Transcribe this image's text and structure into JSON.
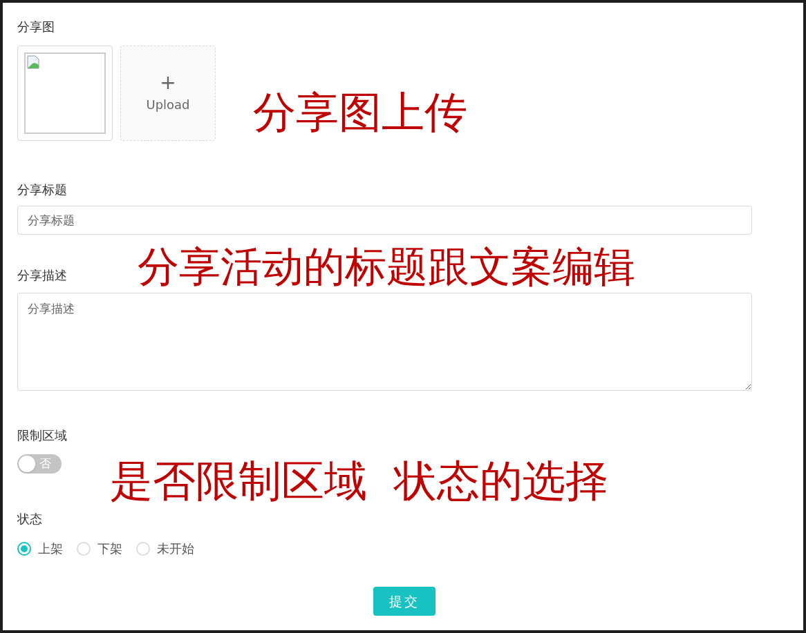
{
  "share_image": {
    "label": "分享图",
    "upload_label": "Upload",
    "upload_symbol": "+"
  },
  "share_title": {
    "label": "分享标题",
    "placeholder": "分享标题"
  },
  "share_description": {
    "label": "分享描述",
    "placeholder": "分享描述"
  },
  "region_limit": {
    "label": "限制区域",
    "on": false,
    "off_text": "否"
  },
  "status": {
    "label": "状态",
    "options": [
      {
        "label": "上架",
        "selected": true
      },
      {
        "label": "下架",
        "selected": false
      },
      {
        "label": "未开始",
        "selected": false
      }
    ]
  },
  "submit": "提交",
  "annotations": [
    {
      "text": "分享图上传"
    },
    {
      "text": "分享活动的标题跟文案编辑"
    },
    {
      "text": "是否限制区域  状态的选择"
    }
  ]
}
